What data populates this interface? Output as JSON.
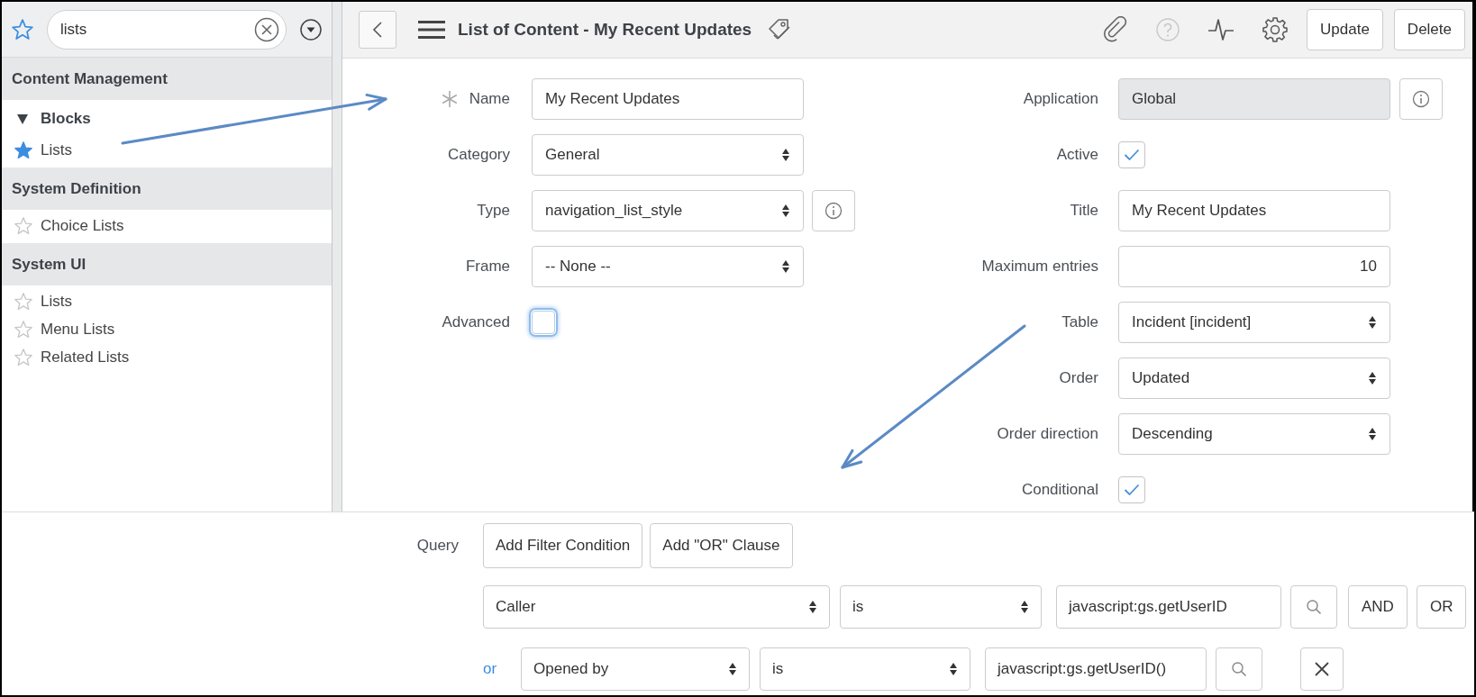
{
  "sidebar": {
    "search": {
      "value": "lists"
    },
    "sections": [
      {
        "title": "Content Management",
        "items": [
          {
            "label": "Blocks",
            "kind": "group",
            "expanded": true,
            "children": [
              {
                "label": "Lists",
                "kind": "module",
                "favorite": true
              }
            ]
          }
        ]
      },
      {
        "title": "System Definition",
        "items": [
          {
            "label": "Choice Lists",
            "kind": "module",
            "favorite": false
          }
        ]
      },
      {
        "title": "System UI",
        "items": [
          {
            "label": "Lists",
            "kind": "module",
            "favorite": false
          },
          {
            "label": "Menu Lists",
            "kind": "module",
            "favorite": false
          },
          {
            "label": "Related Lists",
            "kind": "module",
            "favorite": false
          }
        ]
      }
    ]
  },
  "header": {
    "title": "List of Content - My Recent Updates",
    "buttons": [
      "Update",
      "Delete"
    ]
  },
  "form": {
    "left_fields": [
      {
        "label": "Name",
        "kind": "text",
        "value": "My Recent Updates",
        "required": true
      },
      {
        "label": "Category",
        "kind": "select",
        "value": "General"
      },
      {
        "label": "Type",
        "kind": "select",
        "value": "navigation_list_style",
        "info": true
      },
      {
        "label": "Frame",
        "kind": "select",
        "value": "-- None --"
      },
      {
        "label": "Advanced",
        "kind": "checkbox",
        "checked": false,
        "focused": true
      }
    ],
    "right_fields": [
      {
        "label": "Application",
        "kind": "text",
        "value": "Global",
        "readonly": true,
        "info": true
      },
      {
        "label": "Active",
        "kind": "checkbox",
        "checked": true
      },
      {
        "label": "Title",
        "kind": "text",
        "value": "My Recent Updates"
      },
      {
        "label": "Maximum entries",
        "kind": "number",
        "value": "10"
      },
      {
        "label": "Table",
        "kind": "select",
        "value": "Incident [incident]"
      },
      {
        "label": "Order",
        "kind": "select",
        "value": "Updated"
      },
      {
        "label": "Order direction",
        "kind": "select",
        "value": "Descending"
      },
      {
        "label": "Conditional",
        "kind": "checkbox",
        "checked": true
      }
    ]
  },
  "query": {
    "label": "Query",
    "buttons": [
      "Add Filter Condition",
      "Add \"OR\" Clause"
    ],
    "conditions": [
      {
        "field": "Caller",
        "operator": "is",
        "value": "javascript:gs.getUserID",
        "buttons": [
          "AND",
          "OR"
        ]
      },
      {
        "connector": "or",
        "field": "Opened by",
        "operator": "is",
        "value": "javascript:gs.getUserID()",
        "removable": true
      }
    ]
  }
}
